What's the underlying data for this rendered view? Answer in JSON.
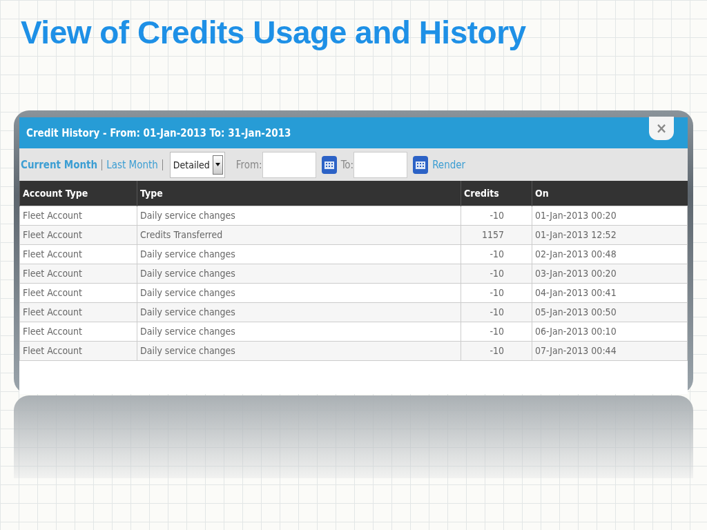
{
  "slide_title": "View of Credits Usage and History",
  "dialog": {
    "title": "Credit History - From: 01-Jan-2013 To: 31-Jan-2013",
    "close": "×"
  },
  "toolbar": {
    "periods": [
      {
        "label": "Current Month",
        "selected": true
      },
      {
        "label": "Last Month",
        "selected": false
      }
    ],
    "view_select": {
      "value": "Detailed"
    },
    "from_label": "From:",
    "to_label": "To:",
    "render": "Render"
  },
  "table": {
    "columns": [
      "Account Type",
      "Type",
      "Credits",
      "On"
    ],
    "rows": [
      [
        "Fleet Account",
        "Daily service changes",
        "-10",
        "01-Jan-2013 00:20"
      ],
      [
        "Fleet Account",
        "Credits Transferred",
        "1157",
        "01-Jan-2013 12:52"
      ],
      [
        "Fleet Account",
        "Daily service changes",
        "-10",
        "02-Jan-2013 00:48"
      ],
      [
        "Fleet Account",
        "Daily service changes",
        "-10",
        "03-Jan-2013 00:20"
      ],
      [
        "Fleet Account",
        "Daily service changes",
        "-10",
        "04-Jan-2013 00:41"
      ],
      [
        "Fleet Account",
        "Daily service changes",
        "-10",
        "05-Jan-2013 00:50"
      ],
      [
        "Fleet Account",
        "Daily service changes",
        "-10",
        "06-Jan-2013 00:10"
      ],
      [
        "Fleet Account",
        "Daily service changes",
        "-10",
        "07-Jan-2013 00:44"
      ]
    ]
  }
}
